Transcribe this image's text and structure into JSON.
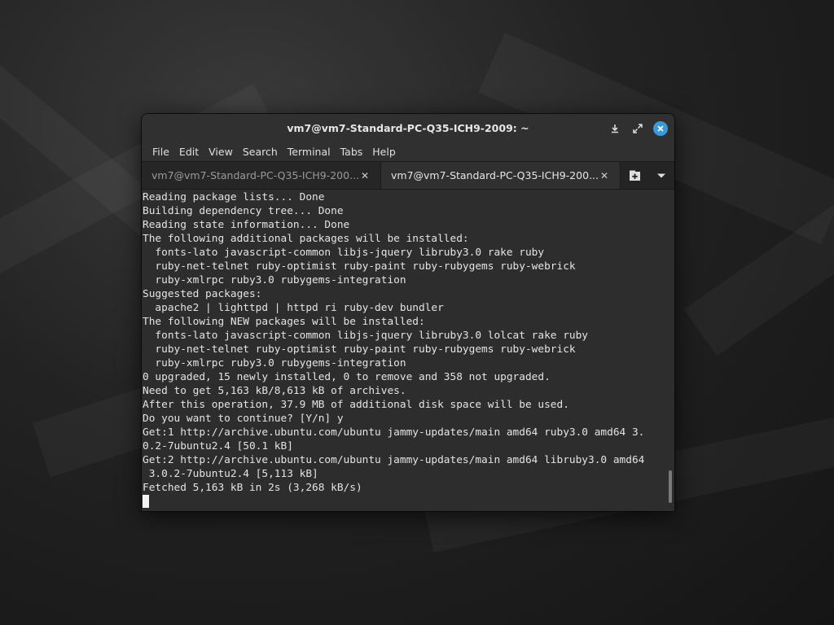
{
  "window": {
    "title": "vm7@vm7-Standard-PC-Q35-ICH9-2009: ~"
  },
  "titlebar": {
    "buttons": [
      {
        "icon": "minimize-icon"
      },
      {
        "icon": "maximize-icon"
      },
      {
        "icon": "close-icon",
        "color": "#3a9ad9"
      }
    ]
  },
  "menubar": {
    "items": [
      "File",
      "Edit",
      "View",
      "Search",
      "Terminal",
      "Tabs",
      "Help"
    ]
  },
  "tabs": [
    {
      "label": "vm7@vm7-Standard-PC-Q35-ICH9-200...",
      "active": false
    },
    {
      "label": "vm7@vm7-Standard-PC-Q35-ICH9-200...",
      "active": true
    }
  ],
  "tab_actions": {
    "new_tab_icon": "new-tab-icon",
    "menu_icon": "chevron-down-icon"
  },
  "terminal": {
    "lines": [
      "Reading package lists... Done",
      "Building dependency tree... Done",
      "Reading state information... Done",
      "The following additional packages will be installed:",
      "  fonts-lato javascript-common libjs-jquery libruby3.0 rake ruby",
      "  ruby-net-telnet ruby-optimist ruby-paint ruby-rubygems ruby-webrick",
      "  ruby-xmlrpc ruby3.0 rubygems-integration",
      "Suggested packages:",
      "  apache2 | lighttpd | httpd ri ruby-dev bundler",
      "The following NEW packages will be installed:",
      "  fonts-lato javascript-common libjs-jquery libruby3.0 lolcat rake ruby",
      "  ruby-net-telnet ruby-optimist ruby-paint ruby-rubygems ruby-webrick",
      "  ruby-xmlrpc ruby3.0 rubygems-integration",
      "0 upgraded, 15 newly installed, 0 to remove and 358 not upgraded.",
      "Need to get 5,163 kB/8,613 kB of archives.",
      "After this operation, 37.9 MB of additional disk space will be used.",
      "Do you want to continue? [Y/n] y",
      "Get:1 http://archive.ubuntu.com/ubuntu jammy-updates/main amd64 ruby3.0 amd64 3.",
      "0.2-7ubuntu2.4 [50.1 kB]",
      "Get:2 http://archive.ubuntu.com/ubuntu jammy-updates/main amd64 libruby3.0 amd64",
      " 3.0.2-7ubuntu2.4 [5,113 kB]",
      "Fetched 5,163 kB in 2s (3,268 kB/s)"
    ]
  }
}
